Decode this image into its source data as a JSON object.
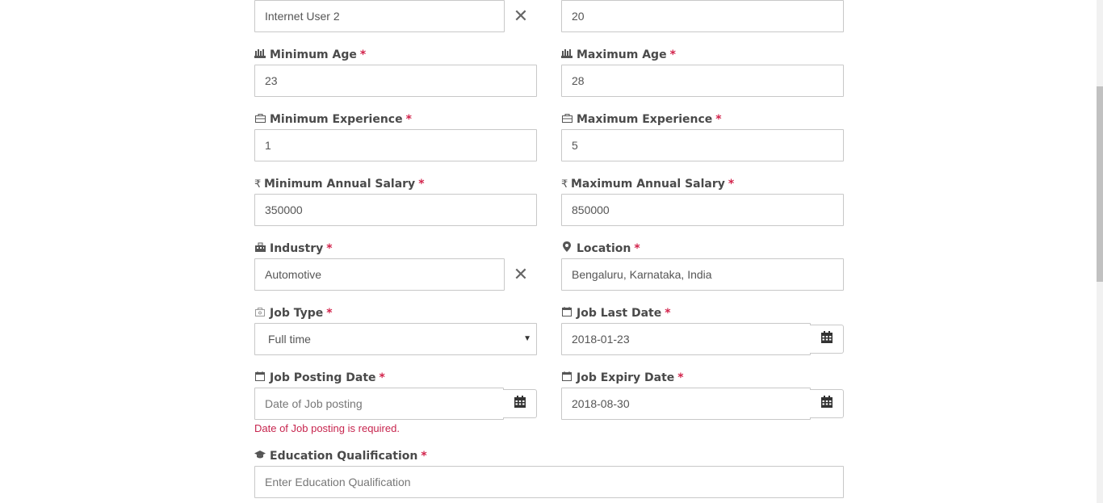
{
  "form": {
    "top_left_value": "Internet User 2",
    "top_right_value": "20",
    "min_age": {
      "label": "Minimum Age",
      "value": "23",
      "icon": "users-icon"
    },
    "max_age": {
      "label": "Maximum Age",
      "value": "28",
      "icon": "users-icon"
    },
    "min_exp": {
      "label": "Minimum Experience",
      "value": "1",
      "icon": "briefcase-icon"
    },
    "max_exp": {
      "label": "Maximum Experience",
      "value": "5",
      "icon": "briefcase-icon"
    },
    "min_salary": {
      "label": "Minimum Annual Salary",
      "value": "350000",
      "icon": "rupee-icon"
    },
    "max_salary": {
      "label": "Maximum Annual Salary",
      "value": "850000",
      "icon": "rupee-icon"
    },
    "industry": {
      "label": "Industry",
      "value": "Automotive",
      "icon": "industry-icon"
    },
    "location": {
      "label": "Location",
      "value": "Bengaluru, Karnataka, India",
      "icon": "map-pin-icon"
    },
    "job_type": {
      "label": "Job Type",
      "value": "Full time",
      "icon": "job-type-icon"
    },
    "job_last_date": {
      "label": "Job Last Date",
      "value": "2018-01-23",
      "icon": "calendar-icon"
    },
    "job_posting_date": {
      "label": "Job Posting Date",
      "placeholder": "Date of Job posting",
      "error": "Date of Job posting is required.",
      "icon": "calendar-icon"
    },
    "job_expiry_date": {
      "label": "Job Expiry Date",
      "value": "2018-08-30",
      "icon": "calendar-icon"
    },
    "education": {
      "label": "Education Qualification",
      "placeholder": "Enter Education Qualification",
      "icon": "graduation-cap-icon"
    },
    "required_marker": "*",
    "clear_symbol": "✕"
  },
  "colors": {
    "required": "#d2234b",
    "error": "#c7254e",
    "border": "#c8c8c8"
  }
}
